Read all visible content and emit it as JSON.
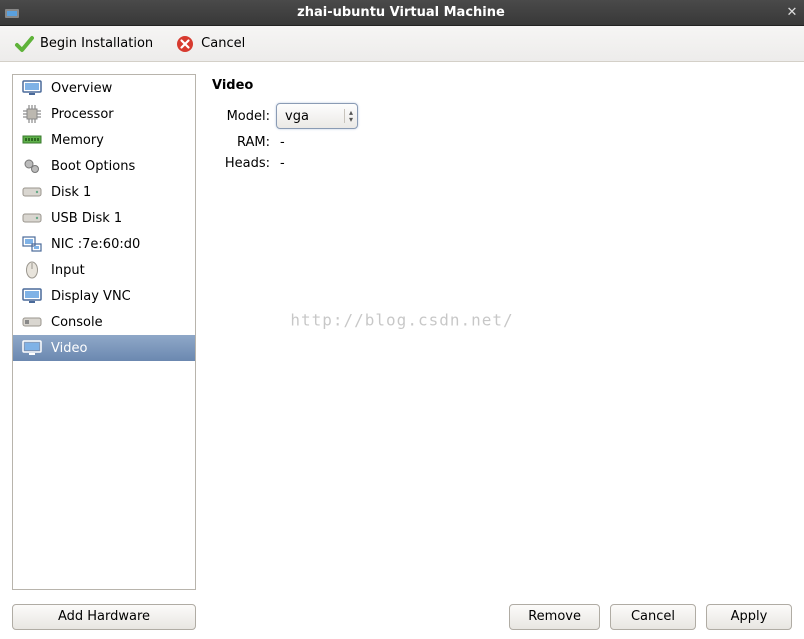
{
  "titlebar": {
    "title": "zhai-ubuntu Virtual Machine"
  },
  "toolbar": {
    "begin_label": "Begin Installation",
    "cancel_label": "Cancel"
  },
  "sidebar": {
    "items": [
      {
        "label": "Overview",
        "icon": "monitor-icon"
      },
      {
        "label": "Processor",
        "icon": "cpu-icon"
      },
      {
        "label": "Memory",
        "icon": "ram-icon"
      },
      {
        "label": "Boot Options",
        "icon": "gears-icon"
      },
      {
        "label": "Disk 1",
        "icon": "disk-icon"
      },
      {
        "label": "USB Disk 1",
        "icon": "disk-icon"
      },
      {
        "label": "NIC :7e:60:d0",
        "icon": "nic-icon"
      },
      {
        "label": "Input",
        "icon": "mouse-icon"
      },
      {
        "label": "Display VNC",
        "icon": "monitor-icon"
      },
      {
        "label": "Console",
        "icon": "console-icon"
      },
      {
        "label": "Video",
        "icon": "monitor-icon",
        "selected": true
      }
    ]
  },
  "content": {
    "section_title": "Video",
    "model_label": "Model:",
    "model_value": "vga",
    "ram_label": "RAM:",
    "ram_value": "-",
    "heads_label": "Heads:",
    "heads_value": "-"
  },
  "buttons": {
    "add_hardware": "Add Hardware",
    "remove": "Remove",
    "cancel": "Cancel",
    "apply": "Apply"
  },
  "watermark": "http://blog.csdn.net/"
}
